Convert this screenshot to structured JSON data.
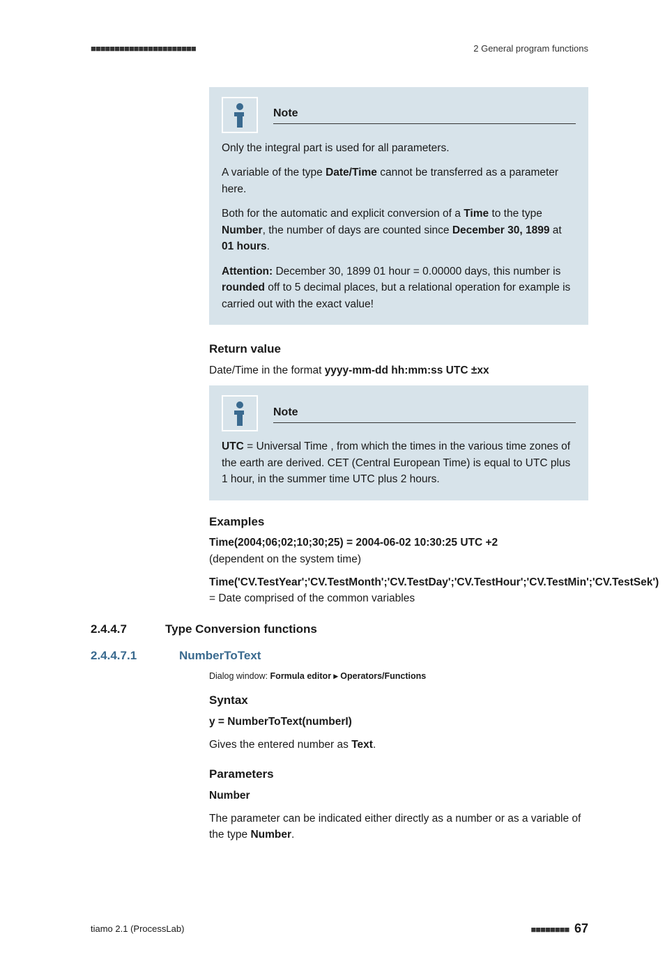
{
  "header": {
    "ticks": "■■■■■■■■■■■■■■■■■■■■■■",
    "chapter": "2 General program functions"
  },
  "note1": {
    "title": "Note",
    "p1": "Only the integral part is used for all parameters.",
    "p2_a": "A variable of the type ",
    "p2_bold": "Date/Time",
    "p2_b": " cannot be transferred as a parameter here.",
    "p3_a": "Both for the automatic and explicit conversion of a ",
    "p3_b1": "Time",
    "p3_b": " to the type ",
    "p3_b2": "Number",
    "p3_c": ", the number of days are counted since ",
    "p3_b3": "December 30, 1899",
    "p3_d": " at ",
    "p3_b4": "01 hours",
    "p3_e": ".",
    "p4_b1": "Attention:",
    "p4_a": " December 30, 1899 01 hour = 0.00000 days, this number is ",
    "p4_b2": "rounded",
    "p4_b": " off to 5 decimal places, but a relational operation for example is carried out with the exact value!"
  },
  "return": {
    "heading": "Return value",
    "text_a": "Date/Time in the format ",
    "text_bold": "yyyy-mm-dd hh:mm:ss UTC ±xx"
  },
  "note2": {
    "title": "Note",
    "p1_b": "UTC",
    "p1_a": " = Universal Time , from which the times in the various time zones of the earth are derived. CET (Central European Time) is equal to UTC plus 1 hour, in the summer time UTC plus 2 hours."
  },
  "examples": {
    "heading": "Examples",
    "ex1_bold": "Time(2004;06;02;10;30;25) = 2004-06-02 10:30:25 UTC +2",
    "ex1_after": "(dependent on the system time)",
    "ex2_bold": "Time('CV.TestYear';'CV.TestMonth';'CV.TestDay';'CV.TestHour';'CV.TestMin';'CV.TestSek')",
    "ex2_after": " = Date comprised of the common variables"
  },
  "sec2447": {
    "num": "2.4.4.7",
    "title": "Type Conversion functions"
  },
  "sec24471": {
    "num": "2.4.4.7.1",
    "title": "NumberToText",
    "dialog_a": "Dialog window: ",
    "dialog_b": "Formula editor ▸ Operators/Functions"
  },
  "syntax": {
    "heading": "Syntax",
    "line": "y = NumberToText(numberI)",
    "desc_a": "Gives the entered number as ",
    "desc_bold": "Text",
    "desc_b": "."
  },
  "params": {
    "heading": "Parameters",
    "sub": "Number",
    "desc_a": "The parameter can be indicated either directly as a number or as a variable of the type ",
    "desc_bold": "Number",
    "desc_b": "."
  },
  "footer": {
    "product": "tiamo 2.1 (ProcessLab)",
    "ticks": "■■■■■■■■",
    "page": "67"
  }
}
